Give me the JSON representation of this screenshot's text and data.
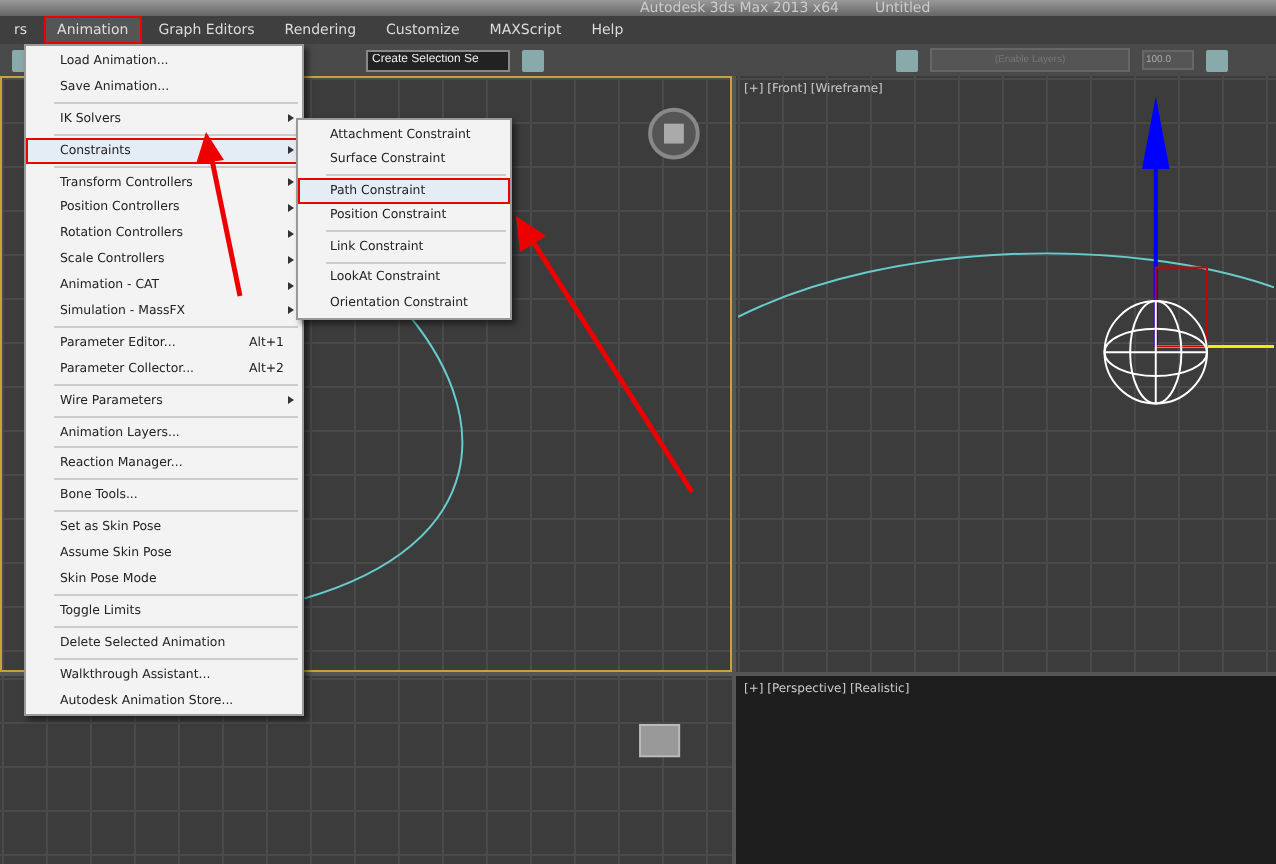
{
  "title_bar": {
    "app": "Autodesk 3ds Max  2013 x64",
    "document": "Untitled"
  },
  "menu_bar": [
    {
      "label": "rs",
      "selected": false
    },
    {
      "label": "Animation",
      "selected": true
    },
    {
      "label": "Graph Editors",
      "selected": false
    },
    {
      "label": "Rendering",
      "selected": false
    },
    {
      "label": "Customize",
      "selected": false
    },
    {
      "label": "MAXScript",
      "selected": false
    },
    {
      "label": "Help",
      "selected": false
    }
  ],
  "toolbar": {
    "selection_set": {
      "placeholder": "Create Selection Se"
    },
    "layers": {
      "placeholder": "(Enable Layers)",
      "disabled": true
    },
    "spinner": {
      "value": "100.0"
    }
  },
  "animation_menu": {
    "sections": [
      [
        {
          "label": "Load Animation...",
          "submenu": false,
          "selected": false
        },
        {
          "label": "Save Animation...",
          "submenu": false,
          "selected": false
        }
      ],
      [
        {
          "label": "IK Solvers",
          "submenu": true,
          "selected": false
        }
      ],
      [
        {
          "label": "Constraints",
          "submenu": true,
          "selected": true
        }
      ],
      [
        {
          "label": "Transform Controllers",
          "submenu": true,
          "selected": false
        },
        {
          "label": "Position Controllers",
          "submenu": true,
          "selected": false
        },
        {
          "label": "Rotation Controllers",
          "submenu": true,
          "selected": false
        },
        {
          "label": "Scale Controllers",
          "submenu": true,
          "selected": false
        },
        {
          "label": "Animation - CAT",
          "submenu": true,
          "selected": false
        },
        {
          "label": "Simulation - MassFX",
          "submenu": true,
          "selected": false
        }
      ],
      [
        {
          "label": "Parameter Editor...",
          "shortcut": "Alt+1",
          "submenu": false,
          "selected": false
        },
        {
          "label": "Parameter Collector...",
          "shortcut": "Alt+2",
          "submenu": false,
          "selected": false
        }
      ],
      [
        {
          "label": "Wire Parameters",
          "submenu": true,
          "selected": false
        }
      ],
      [
        {
          "label": "Animation Layers...",
          "submenu": false,
          "selected": false
        }
      ],
      [
        {
          "label": "Reaction Manager...",
          "submenu": false,
          "selected": false
        }
      ],
      [
        {
          "label": "Bone Tools...",
          "submenu": false,
          "selected": false
        }
      ],
      [
        {
          "label": "Set as Skin Pose",
          "submenu": false,
          "selected": false
        },
        {
          "label": "Assume Skin Pose",
          "submenu": false,
          "selected": false
        },
        {
          "label": "Skin Pose Mode",
          "submenu": false,
          "selected": false
        }
      ],
      [
        {
          "label": "Toggle Limits",
          "submenu": false,
          "selected": false
        }
      ],
      [
        {
          "label": "Delete Selected Animation",
          "submenu": false,
          "selected": false
        }
      ],
      [
        {
          "label": "Walkthrough Assistant...",
          "submenu": false,
          "selected": false
        },
        {
          "label": "Autodesk Animation Store...",
          "submenu": false,
          "selected": false
        }
      ]
    ]
  },
  "constraints_submenu": {
    "sections": [
      [
        {
          "label": "Attachment Constraint",
          "selected": false
        },
        {
          "label": "Surface Constraint",
          "selected": false
        }
      ],
      [
        {
          "label": "Path Constraint",
          "selected": true
        },
        {
          "label": "Position Constraint",
          "selected": false
        }
      ],
      [
        {
          "label": "Link Constraint",
          "selected": false
        }
      ],
      [
        {
          "label": "LookAt Constraint",
          "selected": false
        },
        {
          "label": "Orientation Constraint",
          "selected": false
        }
      ]
    ]
  },
  "viewports": [
    {
      "kind": "top",
      "active": true
    },
    {
      "kind": "front",
      "label": "[+] [Front] [Wireframe]",
      "active": false
    },
    {
      "kind": "left",
      "active": false
    },
    {
      "kind": "perspective",
      "label": "[+] [Perspective] [Realistic]",
      "active": false
    }
  ]
}
